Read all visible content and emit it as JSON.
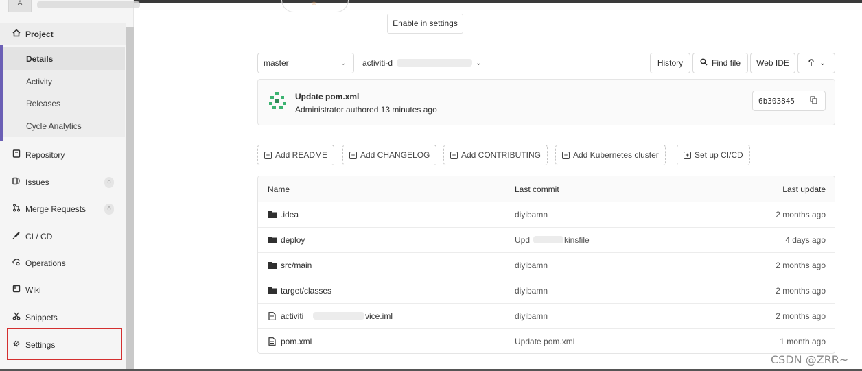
{
  "sidebar": {
    "avatar_letter": "A",
    "project_label": "Project",
    "project_sub": [
      {
        "label": "Details",
        "active": true
      },
      {
        "label": "Activity"
      },
      {
        "label": "Releases"
      },
      {
        "label": "Cycle Analytics"
      }
    ],
    "items": [
      {
        "label": "Repository",
        "icon": "repository-icon"
      },
      {
        "label": "Issues",
        "icon": "issues-icon",
        "badge": "0"
      },
      {
        "label": "Merge Requests",
        "icon": "merge-request-icon",
        "badge": "0"
      },
      {
        "label": "CI / CD",
        "icon": "rocket-icon"
      },
      {
        "label": "Operations",
        "icon": "cloud-gear-icon"
      },
      {
        "label": "Wiki",
        "icon": "book-icon"
      },
      {
        "label": "Snippets",
        "icon": "scissors-icon"
      },
      {
        "label": "Settings",
        "icon": "gear-icon"
      }
    ]
  },
  "main": {
    "enable_settings_label": "Enable in settings",
    "branch": "master",
    "path_prefix": "activiti-d",
    "buttons": {
      "history": "History",
      "find_file": "Find file",
      "web_ide": "Web IDE"
    },
    "commit": {
      "title": "Update pom.xml",
      "meta": "Administrator authored 13 minutes ago",
      "sha": "6b303845"
    },
    "add_buttons": [
      "Add README",
      "Add CHANGELOG",
      "Add CONTRIBUTING",
      "Add Kubernetes cluster",
      "Set up CI/CD"
    ],
    "table": {
      "headers": {
        "name": "Name",
        "last_commit": "Last commit",
        "last_update": "Last update"
      },
      "rows": [
        {
          "name": ".idea",
          "type": "folder",
          "commit": "diyibamn",
          "update": "2 months ago"
        },
        {
          "name": "deploy",
          "type": "folder",
          "commit": "Upd",
          "commit_tail": "kinsfile",
          "update": "4 days ago"
        },
        {
          "name": "src/main",
          "type": "folder",
          "commit": "diyibamn",
          "update": "2 months ago"
        },
        {
          "name": "target/classes",
          "type": "folder",
          "commit": "diyibamn",
          "update": "2 months ago"
        },
        {
          "name": "activiti",
          "name_tail": "vice.iml",
          "type": "file",
          "commit": "diyibamn",
          "update": "2 months ago"
        },
        {
          "name": "pom.xml",
          "type": "file",
          "commit": "Update pom.xml",
          "update": "1 month ago"
        }
      ]
    }
  },
  "watermark": "CSDN @ZRR~"
}
